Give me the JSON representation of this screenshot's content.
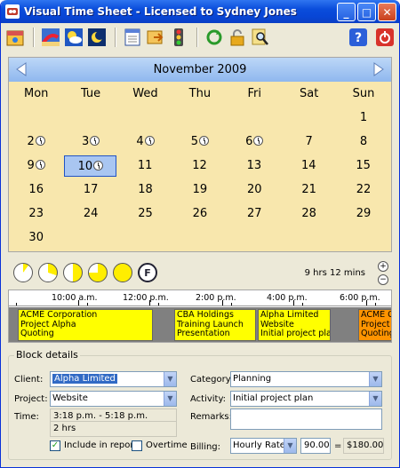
{
  "window": {
    "title": "Visual Time Sheet - Licensed to Sydney Jones"
  },
  "toolbar": {
    "icons": [
      "calendar-icon",
      "beach-vacation-icon",
      "weather-icon",
      "moon-night-icon",
      "list-icon",
      "export-icon",
      "traffic-light-icon",
      "refresh-icon",
      "lock-icon",
      "search-icon",
      "help-icon",
      "power-icon"
    ]
  },
  "calendar": {
    "month_label": "November 2009",
    "weekdays": [
      "Mon",
      "Tue",
      "Wed",
      "Thu",
      "Fri",
      "Sat",
      "Sun"
    ],
    "weeks": [
      [
        "",
        "",
        "",
        "",
        "",
        "",
        "1"
      ],
      [
        "2",
        "3",
        "4",
        "5",
        "6",
        "7",
        "8"
      ],
      [
        "9",
        "10",
        "11",
        "12",
        "13",
        "14",
        "15"
      ],
      [
        "16",
        "17",
        "18",
        "19",
        "20",
        "21",
        "22"
      ],
      [
        "23",
        "24",
        "25",
        "26",
        "27",
        "28",
        "29"
      ],
      [
        "30",
        "",
        "",
        "",
        "",
        "",
        ""
      ]
    ],
    "days_with_entries": [
      "2",
      "3",
      "4",
      "5",
      "6",
      "9",
      "10"
    ],
    "selected_day": "10"
  },
  "summary": {
    "total_hours": "9 hrs 12 mins",
    "pie_fractions": [
      0.1,
      0.3,
      0.5,
      0.75,
      1.0
    ],
    "f_button": "F",
    "zoom_in": "+",
    "zoom_out": "−"
  },
  "timeline": {
    "ticks": [
      "10:00 a.m.",
      "12:00 p.m.",
      "2:00 p.m.",
      "4:00 p.m.",
      "6:00 p.m."
    ],
    "blocks": [
      {
        "lines": [
          "ACME Corporation",
          "Project Alpha",
          "Quoting"
        ],
        "color": "#ffff00"
      },
      {
        "lines": [
          "CBA Holdings",
          "Training Launch",
          "Presentation"
        ],
        "color": "#ffff00"
      },
      {
        "lines": [
          "Alpha Limited",
          "Website",
          "Initial project plan"
        ],
        "color": "#ffff00"
      },
      {
        "lines": [
          "ACME Corpora",
          "Project A",
          "Quoting"
        ],
        "color": "#ff9400"
      }
    ]
  },
  "details": {
    "legend": "Block details",
    "client_label": "Client:",
    "client_value": "Alpha Limited",
    "project_label": "Project:",
    "project_value": "Website",
    "time_label": "Time:",
    "time_value": "3:18 p.m. - 5:18 p.m.",
    "duration_value": "2 hrs",
    "include_label": "Include in reports",
    "include_checked": true,
    "overtime_label": "Overtime",
    "overtime_checked": false,
    "category_label": "Category:",
    "category_value": "Planning",
    "activity_label": "Activity:",
    "activity_value": "Initial project plan",
    "remarks_label": "Remarks:",
    "remarks_value": "",
    "billing_label": "Billing:",
    "billing_value": "Hourly Rate",
    "rate_value": "90.00",
    "equals": "=",
    "amount_value": "$180.00"
  }
}
